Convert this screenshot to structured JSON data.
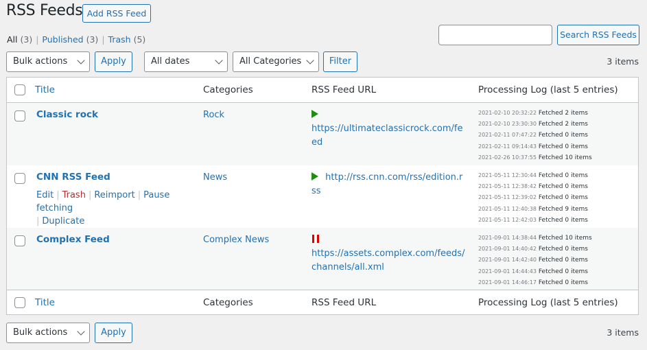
{
  "header": {
    "title": "RSS Feeds",
    "add_button": "Add RSS Feed"
  },
  "views": [
    {
      "label": "All",
      "count": "(3)",
      "current": true
    },
    {
      "label": "Published",
      "count": "(3)",
      "current": false
    },
    {
      "label": "Trash",
      "count": "(5)",
      "current": false
    }
  ],
  "search": {
    "value": "",
    "placeholder": "",
    "button": "Search RSS Feeds"
  },
  "top_nav": {
    "bulk_actions": "Bulk actions",
    "apply": "Apply",
    "dates": "All dates",
    "categories": "All Categories",
    "filter": "Filter",
    "count": "3 items"
  },
  "bottom_nav": {
    "bulk_actions": "Bulk actions",
    "apply": "Apply",
    "count": "3 items"
  },
  "columns": {
    "title": "Title",
    "categories": "Categories",
    "url": "RSS Feed URL",
    "log": "Processing Log (last 5 entries)"
  },
  "row_actions": {
    "edit": "Edit",
    "trash": "Trash",
    "reimport": "Reimport",
    "pause": "Pause fetching",
    "duplicate": "Duplicate"
  },
  "status_colors": {
    "active": "#1e8e0e",
    "paused": "#e00000"
  },
  "rows": [
    {
      "title": "Classic rock",
      "category": "Rock",
      "status_icon": "play-icon",
      "url": "https://ultimateclassicrock.com/feed",
      "log": [
        {
          "ts": "2021-02-10 20:32:22",
          "msg": "Fetched 2 items"
        },
        {
          "ts": "2021-02-10 23:30:30",
          "msg": "Fetched 2 items"
        },
        {
          "ts": "2021-02-11 07:47:22",
          "msg": "Fetched 0 items"
        },
        {
          "ts": "2021-02-11 09:14:43",
          "msg": "Fetched 0 items"
        },
        {
          "ts": "2021-02-26 10:37:55",
          "msg": "Fetched 10 items"
        }
      ]
    },
    {
      "title": "CNN RSS Feed",
      "category": "News",
      "status_icon": "play-icon",
      "url": "http://rss.cnn.com/rss/edition.rss",
      "log": [
        {
          "ts": "2021-05-11 12:30:44",
          "msg": "Fetched 0 items"
        },
        {
          "ts": "2021-05-11 12:38:42",
          "msg": "Fetched 0 items"
        },
        {
          "ts": "2021-05-11 12:39:02",
          "msg": "Fetched 0 items"
        },
        {
          "ts": "2021-05-11 12:40:38",
          "msg": "Fetched 9 items"
        },
        {
          "ts": "2021-05-11 12:42:03",
          "msg": "Fetched 0 items"
        }
      ]
    },
    {
      "title": "Complex Feed",
      "category": "Complex News",
      "status_icon": "pause-icon",
      "url": "https://assets.complex.com/feeds/channels/all.xml",
      "log": [
        {
          "ts": "2021-09-01 14:38:44",
          "msg": "Fetched 10 items"
        },
        {
          "ts": "2021-09-01 14:40:42",
          "msg": "Fetched 0 items"
        },
        {
          "ts": "2021-09-01 14:42:40",
          "msg": "Fetched 0 items"
        },
        {
          "ts": "2021-09-01 14:44:43",
          "msg": "Fetched 0 items"
        },
        {
          "ts": "2021-09-01 14:46:17",
          "msg": "Fetched 0 items"
        }
      ]
    }
  ]
}
